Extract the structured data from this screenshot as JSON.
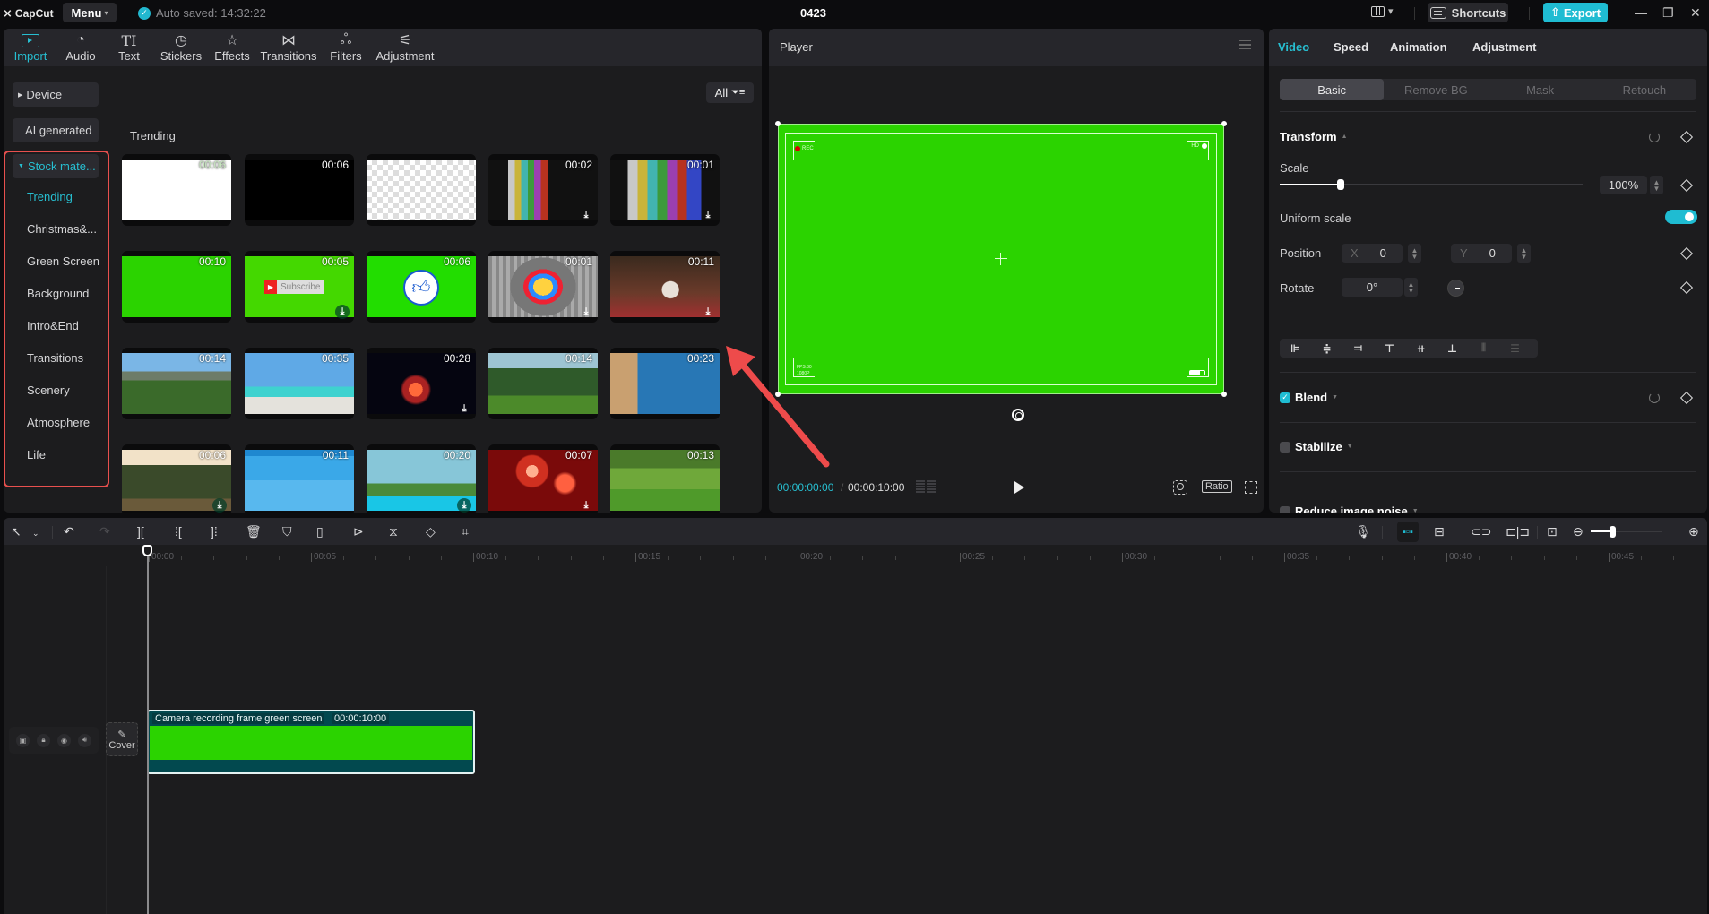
{
  "titlebar": {
    "app_name": "CapCut",
    "menu_label": "Menu",
    "autosave": "Auto saved: 14:32:22",
    "project_name": "0423",
    "shortcuts_label": "Shortcuts",
    "export_label": "Export",
    "minimize": "—",
    "restore": "❐",
    "close": "✕"
  },
  "media_tabs": [
    {
      "label": "Import",
      "icon": "import-icon",
      "active": true
    },
    {
      "label": "Audio",
      "icon": "audio-icon"
    },
    {
      "label": "Text",
      "icon": "text-icon"
    },
    {
      "label": "Stickers",
      "icon": "stickers-icon"
    },
    {
      "label": "Effects",
      "icon": "effects-icon"
    },
    {
      "label": "Transitions",
      "icon": "transitions-icon"
    },
    {
      "label": "Filters",
      "icon": "filters-icon"
    },
    {
      "label": "Adjustment",
      "icon": "adjustment-icon"
    }
  ],
  "sidebar": {
    "device": "Device",
    "ai_generated": "AI generated",
    "stock": "Stock mate...",
    "items": [
      {
        "label": "Trending",
        "active": true
      },
      {
        "label": "Christmas&..."
      },
      {
        "label": "Green Screen"
      },
      {
        "label": "Background"
      },
      {
        "label": "Intro&End"
      },
      {
        "label": "Transitions"
      },
      {
        "label": "Scenery"
      },
      {
        "label": "Atmosphere"
      },
      {
        "label": "Life"
      }
    ]
  },
  "media": {
    "filter_label": "All",
    "section_title": "Trending",
    "thumbs": [
      {
        "dur": "00:06",
        "kind": "white",
        "download": false
      },
      {
        "dur": "00:06",
        "kind": "black",
        "download": false
      },
      {
        "dur": "",
        "kind": "transparent",
        "download": false
      },
      {
        "dur": "00:02",
        "kind": "bars-vertical",
        "download": true
      },
      {
        "dur": "00:01",
        "kind": "bars",
        "download": true
      },
      {
        "dur": "00:10",
        "kind": "green",
        "download": false
      },
      {
        "dur": "00:05",
        "kind": "green-subscribe",
        "download": true,
        "caption": "Subscribe"
      },
      {
        "dur": "00:06",
        "kind": "green-like",
        "download": false
      },
      {
        "dur": "00:01",
        "kind": "test-card",
        "download": true
      },
      {
        "dur": "00:11",
        "kind": "christmas",
        "download": true
      },
      {
        "dur": "00:14",
        "kind": "city",
        "download": false
      },
      {
        "dur": "00:35",
        "kind": "beach",
        "download": false
      },
      {
        "dur": "00:28",
        "kind": "fireworks-dark",
        "download": true
      },
      {
        "dur": "00:14",
        "kind": "dancers",
        "download": false
      },
      {
        "dur": "00:23",
        "kind": "friends-sea",
        "download": false
      },
      {
        "dur": "00:06",
        "kind": "forest",
        "download": true
      },
      {
        "dur": "00:11",
        "kind": "water",
        "download": false
      },
      {
        "dur": "00:20",
        "kind": "pool",
        "download": true
      },
      {
        "dur": "00:07",
        "kind": "fireworks-red",
        "download": true
      },
      {
        "dur": "00:13",
        "kind": "park",
        "download": false
      }
    ]
  },
  "player": {
    "title": "Player",
    "overlay_rec": "REC",
    "overlay_hd": "HD",
    "overlay_fps": "FPS:30",
    "overlay_res": "1080P",
    "current_time": "00:00:00:00",
    "total_time": "00:00:10:00",
    "ratio_label": "Ratio"
  },
  "props": {
    "tabs": [
      {
        "label": "Video",
        "active": true
      },
      {
        "label": "Speed"
      },
      {
        "label": "Animation"
      },
      {
        "label": "Adjustment"
      }
    ],
    "subtabs": [
      {
        "label": "Basic",
        "active": true
      },
      {
        "label": "Remove BG"
      },
      {
        "label": "Mask"
      },
      {
        "label": "Retouch"
      }
    ],
    "transform_title": "Transform",
    "scale_label": "Scale",
    "scale_value": "100%",
    "scale_slider_fraction": 0.2,
    "uniform_scale_label": "Uniform scale",
    "uniform_scale_on": true,
    "position_label": "Position",
    "pos_x_label": "X",
    "pos_x": "0",
    "pos_y_label": "Y",
    "pos_y": "0",
    "rotate_label": "Rotate",
    "rotate_value": "0°",
    "blend_label": "Blend",
    "blend_checked": true,
    "stabilize_label": "Stabilize",
    "noise_label": "Reduce image noise"
  },
  "timeline": {
    "ruler_labels": [
      "00:00",
      "00:05",
      "00:10",
      "00:15",
      "00:20",
      "00:25",
      "00:30",
      "00:35",
      "00:40",
      "00:45"
    ],
    "cover_label": "Cover",
    "clip_name": "Camera recording frame green screen",
    "clip_duration": "00:00:10:00",
    "zoom_fraction": 0.3
  },
  "colors": {
    "accent": "#1fbcd2",
    "green_screen": "#2bd300",
    "highlight_red": "#e8504e",
    "clip_bg": "#02494f"
  }
}
